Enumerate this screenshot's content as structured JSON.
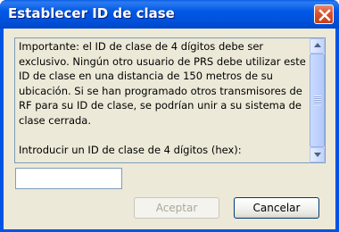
{
  "window": {
    "title": "Establecer ID de clase"
  },
  "message": {
    "body": "Importante: el ID de clase de 4 dígitos debe ser exclusivo. Ningún otro usuario de PRS debe utilizar este ID de clase en una distancia de 150 metros de su ubicación. Si se han programado otros transmisores de RF para su ID de clase, se podrían unir a su sistema de clase cerrada.\n\nIntroducir un ID de clase de 4 dígitos (hex):"
  },
  "input": {
    "class_id_value": ""
  },
  "buttons": {
    "accept_label": "Aceptar",
    "cancel_label": "Cancelar"
  },
  "icons": {
    "close": "close-icon",
    "scroll_up": "scroll-up-arrow-icon",
    "scroll_down": "scroll-down-arrow-icon"
  },
  "colors": {
    "titlebar": "#0058e6",
    "close_button": "#d9532c",
    "dialog_background": "#ece9d8"
  }
}
